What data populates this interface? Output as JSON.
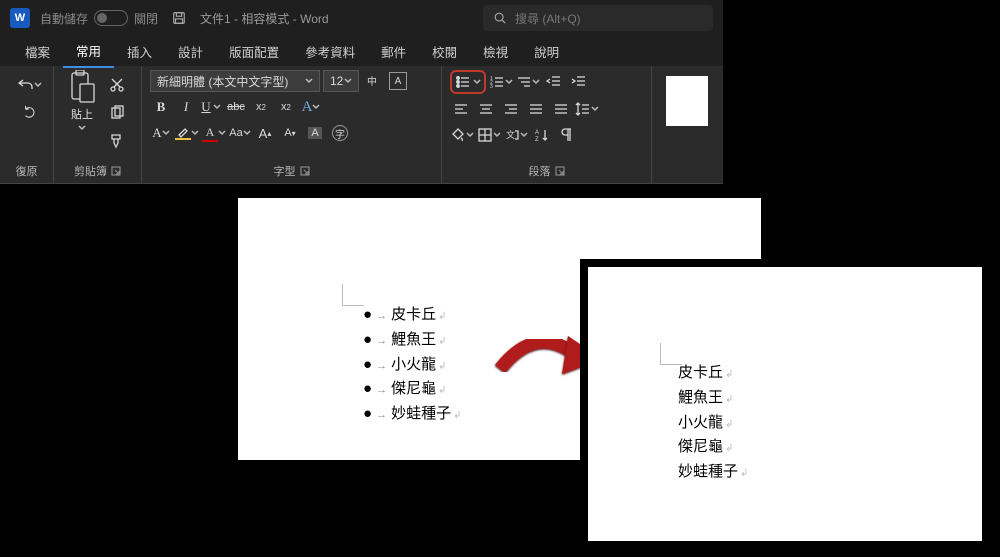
{
  "titlebar": {
    "autosave_label": "自動儲存",
    "autosave_state": "關閉",
    "doc_name": "文件1",
    "mode": "相容模式",
    "app": "Word"
  },
  "search": {
    "placeholder": "搜尋 (Alt+Q)"
  },
  "tabs": {
    "file": "檔案",
    "home": "常用",
    "insert": "插入",
    "design": "設計",
    "layout": "版面配置",
    "references": "參考資料",
    "mailings": "郵件",
    "review": "校閱",
    "view": "檢視",
    "help": "說明"
  },
  "ribbon": {
    "undo_group": "復原",
    "clipboard_group": "剪貼簿",
    "paste": "貼上",
    "font_group": "字型",
    "font_name": "新細明體 (本文中文字型)",
    "font_size": "12",
    "b": "B",
    "i": "I",
    "u": "U",
    "abc": "abc",
    "x2": "x",
    "sup2": "2",
    "A": "A",
    "Aa": "Aa",
    "para_group": "段落",
    "char_A": "A"
  },
  "document": {
    "items": [
      "皮卡丘",
      "鯉魚王",
      "小火龍",
      "傑尼龜",
      "妙蛙種子"
    ]
  }
}
